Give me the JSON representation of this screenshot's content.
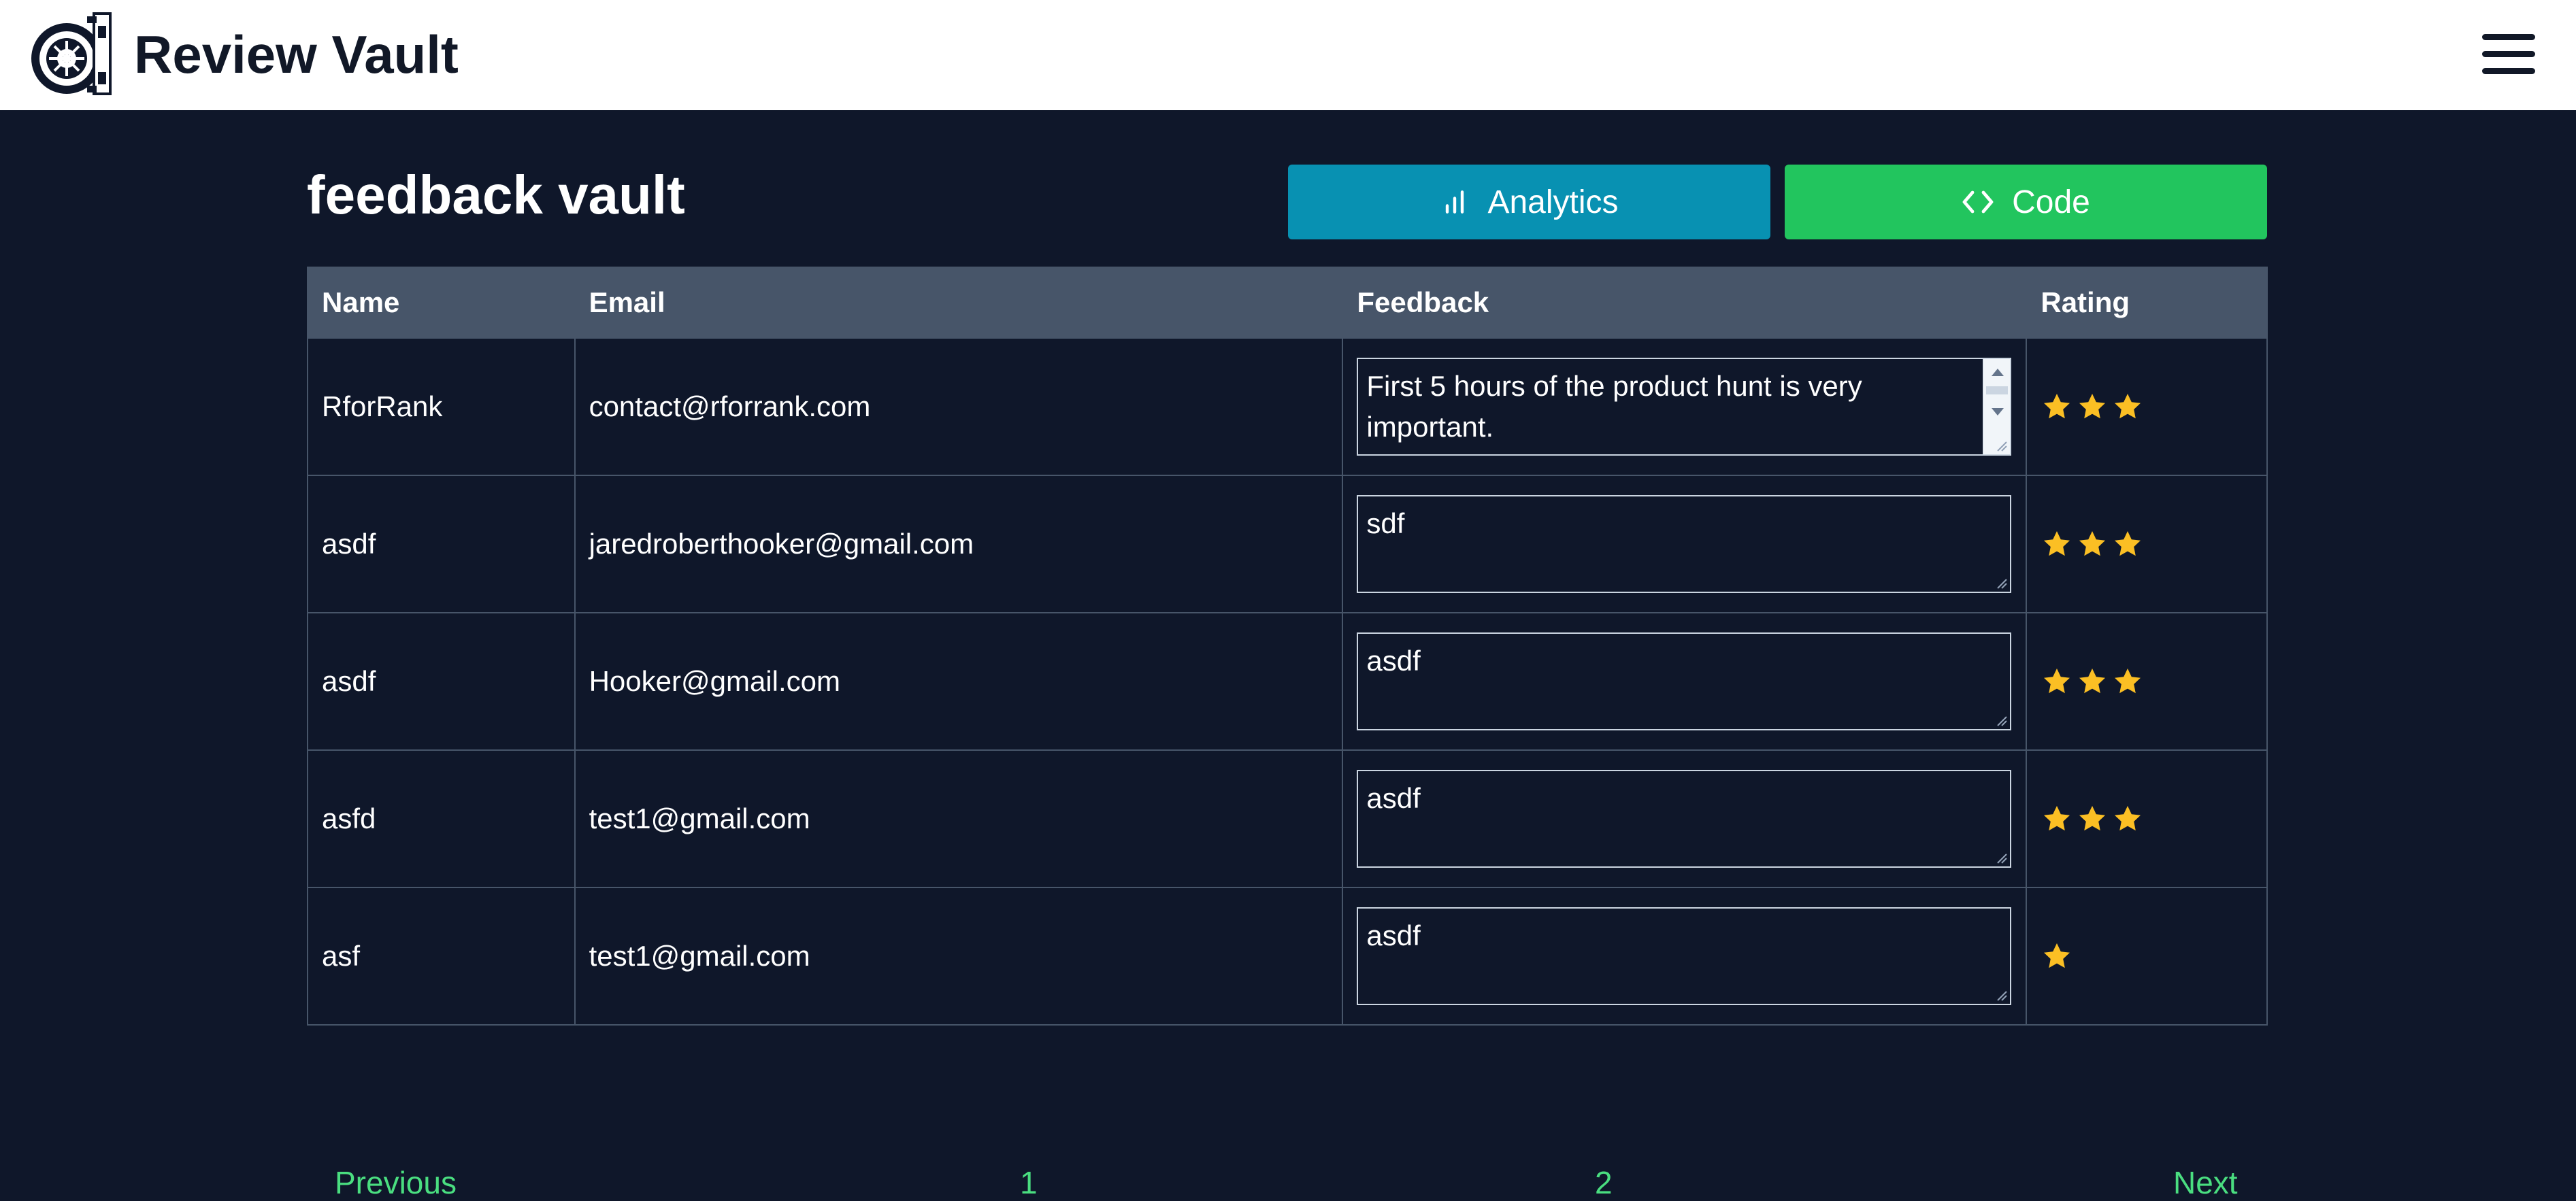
{
  "brand": {
    "name": "Review Vault"
  },
  "header": {
    "title": "feedback vault"
  },
  "toolbar": {
    "analytics_label": "Analytics",
    "code_label": "Code"
  },
  "table": {
    "columns": [
      "Name",
      "Email",
      "Feedback",
      "Rating"
    ],
    "rows": [
      {
        "name": "RforRank",
        "email": "contact@rforrank.com",
        "feedback": "First 5 hours of the product hunt is very important.",
        "rating": 3
      },
      {
        "name": "asdf",
        "email": "jaredroberthooker@gmail.com",
        "feedback": "sdf",
        "rating": 3
      },
      {
        "name": "asdf",
        "email": "Hooker@gmail.com",
        "feedback": "asdf",
        "rating": 3
      },
      {
        "name": "asfd",
        "email": "test1@gmail.com",
        "feedback": "asdf",
        "rating": 3
      },
      {
        "name": "asf",
        "email": "test1@gmail.com",
        "feedback": "asdf",
        "rating": 1
      }
    ]
  },
  "pagination": {
    "previous": "Previous",
    "pages": [
      "1",
      "2"
    ],
    "next": "Next"
  },
  "colors": {
    "background": "#0f172a",
    "analytics": "#0891b2",
    "code": "#22c55e",
    "star": "#fbbf24",
    "link": "#4ade80"
  },
  "icons": {
    "logo": "vault-logo-icon",
    "menu": "hamburger-menu-icon",
    "analytics": "bar-chart-icon",
    "code": "code-brackets-icon",
    "rating": "star-icon"
  }
}
